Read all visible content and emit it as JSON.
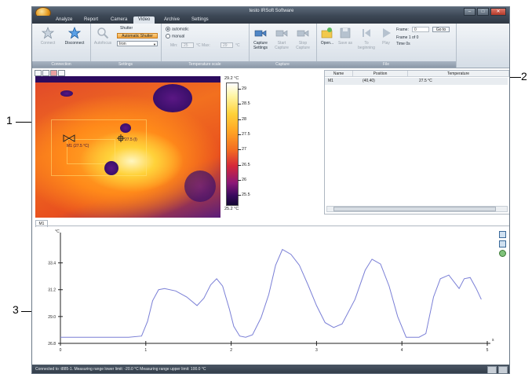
{
  "window": {
    "title": "testo IRSoft Software"
  },
  "tabs": [
    "Analyze",
    "Report",
    "Camera",
    "Video",
    "Archive",
    "Settings"
  ],
  "active_tab": "Video",
  "ribbon": {
    "connection": {
      "label": "Connection",
      "connect": "Connect",
      "disconnect": "Disconnect"
    },
    "settings": {
      "label": "Settings",
      "autofocus": "Autofocus",
      "shutter": "Shutter",
      "auto_shutter": "Automatic Shutter",
      "palette": "Iron"
    },
    "temperature_scale": {
      "label": "Temperature scale",
      "automatic": "automatic",
      "manual": "manual",
      "min_label": "Min:",
      "min_value": "25",
      "max_label": "°C Max:",
      "max_value": "29",
      "unit": "°C"
    },
    "capture": {
      "label": "Capture",
      "settings": "Capture Settings",
      "start": "Start Capture",
      "stop": "Stop Capture"
    },
    "file": {
      "label": "File",
      "open": "Open...",
      "save_as": "Save as",
      "to_beginning": "To beginning",
      "play": "Play",
      "frame_label": "Frame:",
      "frame_value": "0",
      "goto": "Go to",
      "frame_info": "Frame 1 of 0",
      "time": "Time 0s"
    }
  },
  "image": {
    "scale_max": "29.2 °C",
    "scale_min": "25.2 °C",
    "scale_ticks": [
      "29",
      "28.5",
      "28",
      "27.5",
      "27",
      "26.5",
      "26",
      "25.5"
    ],
    "marker_label_left": "M1 (27.5 °C)",
    "marker_label_center": "27.5 (I)"
  },
  "measurements": {
    "columns": [
      "Name",
      "Position",
      "Temperature"
    ],
    "rows": [
      {
        "name": "M1",
        "position": "(40,40)",
        "temperature": "27.5 °C"
      }
    ]
  },
  "chart_tab": "M1",
  "chart_data": {
    "type": "line",
    "ylabel": "°C",
    "x_ticks": [
      "0",
      "1",
      "2",
      "3",
      "4",
      "5"
    ],
    "y_ticks": [
      "26.8",
      "29.0",
      "31.2",
      "33.4"
    ],
    "xlim": [
      0,
      5
    ],
    "ylim": [
      26.8,
      35.5
    ],
    "series": [
      {
        "color": "#7a7fd6",
        "x": [
          0,
          0.4,
          0.8,
          0.95,
          1.02,
          1.08,
          1.15,
          1.22,
          1.35,
          1.48,
          1.6,
          1.68,
          1.76,
          1.83,
          1.9,
          1.98,
          2.03,
          2.1,
          2.17,
          2.25,
          2.35,
          2.44,
          2.52,
          2.6,
          2.7,
          2.8,
          2.9,
          3.0,
          3.1,
          3.2,
          3.3,
          3.45,
          3.57,
          3.65,
          3.75,
          3.85,
          3.95,
          4.05,
          4.12,
          4.2,
          4.28,
          4.37,
          4.45,
          4.55,
          4.67,
          4.73,
          4.8,
          4.87,
          4.93
        ],
        "values": [
          27.3,
          27.3,
          27.3,
          27.4,
          28.6,
          30.3,
          31.2,
          31.3,
          31.1,
          30.6,
          29.9,
          30.5,
          31.6,
          32.1,
          31.5,
          29.6,
          28.2,
          27.4,
          27.3,
          27.5,
          28.9,
          30.8,
          33.2,
          34.5,
          34.1,
          33.2,
          31.6,
          29.9,
          28.5,
          28.1,
          28.4,
          30.4,
          32.8,
          33.7,
          33.3,
          31.5,
          29.0,
          27.3,
          27.3,
          27.3,
          27.6,
          30.6,
          32.1,
          32.4,
          31.3,
          32.1,
          32.2,
          31.3,
          30.4
        ]
      }
    ]
  },
  "statusbar": {
    "text": "Connected to :t885-1.  Measuring range lower limit: -20.0 °C   Measuring range upper limit: 100.0 °C"
  },
  "callouts": {
    "one": "1",
    "two": "2",
    "three": "3"
  }
}
